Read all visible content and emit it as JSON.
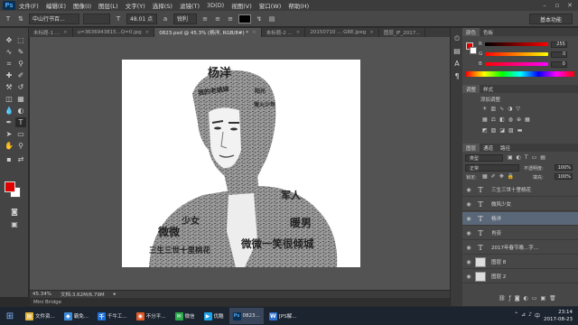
{
  "app": {
    "logo": "Ps"
  },
  "menu": [
    "文件(F)",
    "编辑(E)",
    "图像(I)",
    "图层(L)",
    "文字(Y)",
    "选择(S)",
    "滤镜(T)",
    "3D(D)",
    "视图(V)",
    "窗口(W)",
    "帮助(H)"
  ],
  "options": {
    "font_family": "中山行书百...",
    "font_size": "48.01 点",
    "antialias": "锐利",
    "workspace": "基本功能"
  },
  "tabs": [
    {
      "label": "未标题-1 ...",
      "active": false
    },
    {
      "label": "u=3636943815...Q=0.jpg",
      "active": false
    },
    {
      "label": "0823.psd @ 45.3% (杨洋, RGB/8#) *",
      "active": true
    },
    {
      "label": "未标题-2 ...",
      "active": false
    },
    {
      "label": "20150710 ... GRE.jpeg",
      "active": false
    },
    {
      "label": "图层_IF_2017...",
      "active": false
    }
  ],
  "canvas_texts": [
    {
      "id": "yangyang",
      "text": "杨洋"
    },
    {
      "id": "tl",
      "text": "我的老姚妹"
    },
    {
      "id": "tr",
      "text": "阳光"
    },
    {
      "id": "r2",
      "text": "萤火少年"
    },
    {
      "id": "junren",
      "text": "军人"
    },
    {
      "id": "nuannan",
      "text": "暖男"
    },
    {
      "id": "shaonv",
      "text": "少女"
    },
    {
      "id": "left",
      "text": "微微"
    },
    {
      "id": "bottom1",
      "text": "三生三世十里桃花"
    },
    {
      "id": "bottom2",
      "text": "微微一笑很倾城"
    }
  ],
  "status": {
    "zoom": "45.34%",
    "doc": "文档:3.62M/6.79M",
    "mini_bridge": "Mini Bridge"
  },
  "color_panel": {
    "tabs": [
      "颜色",
      "色板"
    ],
    "rows": [
      {
        "label": "R",
        "value": "255",
        "gradient": "linear-gradient(90deg,#000,#f00)"
      },
      {
        "label": "G",
        "value": "0",
        "gradient": "linear-gradient(90deg,#f00,#ff0)"
      },
      {
        "label": "B",
        "value": "0",
        "gradient": "linear-gradient(90deg,#f00,#f0f)"
      }
    ]
  },
  "adjust_panel": {
    "tabs": [
      "调整",
      "样式"
    ],
    "hint": "添加调整"
  },
  "layers_panel": {
    "tabs": [
      "图层",
      "通道",
      "路径"
    ],
    "kind": "类型",
    "blend": "正常",
    "opacity_label": "不透明度:",
    "opacity": "100%",
    "lock_label": "锁定:",
    "fill_label": "填充:",
    "fill": "100%",
    "layers": [
      {
        "name": "三生三世十里桃花",
        "type": "text",
        "selected": false
      },
      {
        "name": "微风少女",
        "type": "text",
        "selected": false
      },
      {
        "name": "杨洋",
        "type": "text",
        "selected": true
      },
      {
        "name": "肖奈",
        "type": "text",
        "selected": false
      },
      {
        "name": "2017年春节晚...字...",
        "type": "text",
        "selected": false
      },
      {
        "name": "图层 8",
        "type": "img",
        "selected": false
      },
      {
        "name": "图层 2",
        "type": "img",
        "selected": false
      }
    ]
  },
  "taskbar": {
    "items": [
      {
        "label": "文件资...",
        "color": "#e0b440",
        "glyph": "▤"
      },
      {
        "label": "霸免...",
        "color": "#3c8bd8",
        "glyph": "◆"
      },
      {
        "label": "千牛工...",
        "color": "#1e6fd6",
        "glyph": "千"
      },
      {
        "label": "不分平...",
        "color": "#e05a2a",
        "glyph": "◉"
      },
      {
        "label": "微信",
        "color": "#2aa84a",
        "glyph": "✉"
      },
      {
        "label": "优酷",
        "color": "#1aa3e8",
        "glyph": "▶"
      },
      {
        "label": "0823...",
        "color": "#0b2f50",
        "glyph": "Ps"
      },
      {
        "label": "[PS解...",
        "color": "#2e6fd0",
        "glyph": "W"
      }
    ],
    "time": "23:14",
    "date": "2017-08-23"
  }
}
